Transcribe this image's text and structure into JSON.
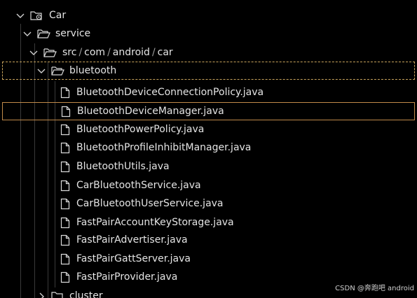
{
  "tree": {
    "root": {
      "label": "Car",
      "icon": "gear-folder-icon",
      "expanded": true
    },
    "service": {
      "label": "service",
      "icon": "folder-open-icon",
      "expanded": true
    },
    "package_path": {
      "segments": [
        "src",
        "com",
        "android",
        "car"
      ],
      "separator": "/",
      "icon": "folder-open-icon",
      "expanded": true
    },
    "bluetooth": {
      "label": "bluetooth",
      "icon": "folder-open-icon",
      "expanded": true,
      "focused": true
    },
    "files": [
      {
        "label": "BluetoothDeviceConnectionPolicy.java",
        "icon": "file-icon"
      },
      {
        "label": "BluetoothDeviceManager.java",
        "icon": "file-icon",
        "selected": true
      },
      {
        "label": "BluetoothPowerPolicy.java",
        "icon": "file-icon"
      },
      {
        "label": "BluetoothProfileInhibitManager.java",
        "icon": "file-icon"
      },
      {
        "label": "BluetoothUtils.java",
        "icon": "file-icon"
      },
      {
        "label": "CarBluetoothService.java",
        "icon": "file-icon"
      },
      {
        "label": "CarBluetoothUserService.java",
        "icon": "file-icon"
      },
      {
        "label": "FastPairAccountKeyStorage.java",
        "icon": "file-icon"
      },
      {
        "label": "FastPairAdvertiser.java",
        "icon": "file-icon"
      },
      {
        "label": "FastPairGattServer.java",
        "icon": "file-icon"
      },
      {
        "label": "FastPairProvider.java",
        "icon": "file-icon"
      }
    ],
    "cluster": {
      "label": "cluster",
      "icon": "folder-closed-icon",
      "expanded": false
    }
  },
  "watermark": {
    "text": "CSDN @奔跑吧 android"
  },
  "colors": {
    "background": "#000000",
    "text": "#e4e4e4",
    "guide_line": "#3a3a3a",
    "focus_border": "#c9a45c",
    "selection_border": "#c08a4a"
  }
}
